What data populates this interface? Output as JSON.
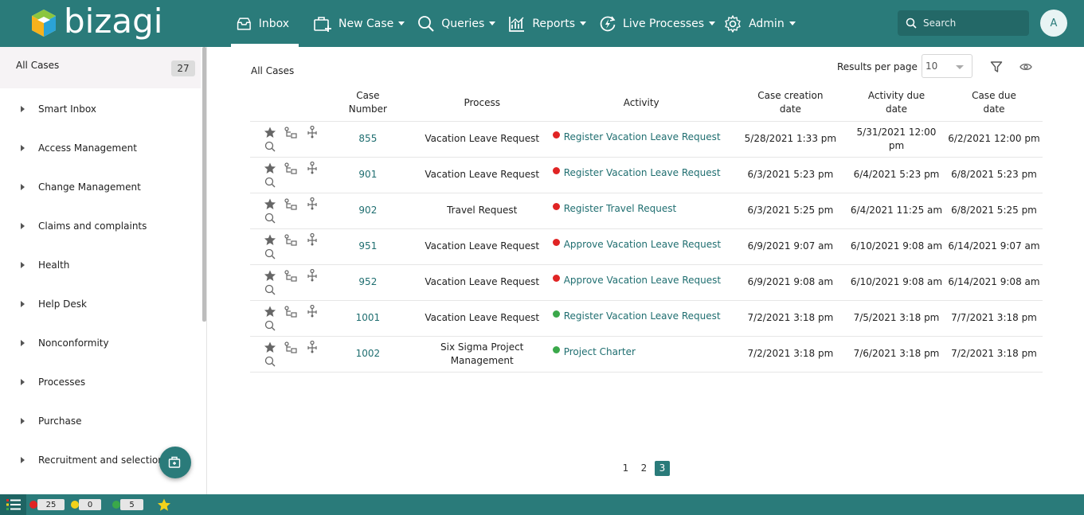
{
  "brand": {
    "name": "bizagi"
  },
  "nav": [
    {
      "label": "Inbox",
      "icon": "inbox-icon",
      "dropdown": false
    },
    {
      "label": "New Case",
      "icon": "new-case-icon",
      "dropdown": true
    },
    {
      "label": "Queries",
      "icon": "search-icon",
      "dropdown": true
    },
    {
      "label": "Reports",
      "icon": "chart-icon",
      "dropdown": true
    },
    {
      "label": "Live Processes",
      "icon": "live-process-icon",
      "dropdown": true
    },
    {
      "label": "Admin",
      "icon": "gear-icon",
      "dropdown": true
    }
  ],
  "search": {
    "placeholder": "Search"
  },
  "user": {
    "initial": "A"
  },
  "sidebar": {
    "all_cases_label": "All Cases",
    "all_cases_count": "27",
    "items": [
      "Smart Inbox",
      "Access Management",
      "Change Management",
      "Claims and complaints",
      "Health",
      "Help Desk",
      "Nonconformity",
      "Processes",
      "Purchase",
      "Recruitment and selection"
    ]
  },
  "main": {
    "title": "All Cases",
    "results_per_page_label": "Results per page",
    "results_per_page_value": "10",
    "columns": {
      "case_number": [
        "Case",
        "Number"
      ],
      "process": "Process",
      "activity": "Activity",
      "creation": [
        "Case creation",
        "date"
      ],
      "activity_due": [
        "Activity due",
        "date"
      ],
      "case_due": [
        "Case due",
        "date"
      ]
    },
    "rows": [
      {
        "number": "855",
        "process": "Vacation Leave Request",
        "activity": "Register Vacation Leave Request",
        "status": "red",
        "created": "5/28/2021 1:33 pm",
        "activity_due": "5/31/2021 12:00 pm",
        "case_due": "6/2/2021 12:00 pm"
      },
      {
        "number": "901",
        "process": "Vacation Leave Request",
        "activity": "Register Vacation Leave Request",
        "status": "red",
        "created": "6/3/2021 5:23 pm",
        "activity_due": "6/4/2021 5:23 pm",
        "case_due": "6/8/2021 5:23 pm"
      },
      {
        "number": "902",
        "process": "Travel Request",
        "activity": "Register Travel Request",
        "status": "red",
        "created": "6/3/2021 5:25 pm",
        "activity_due": "6/4/2021 11:25 am",
        "case_due": "6/8/2021 5:25 pm"
      },
      {
        "number": "951",
        "process": "Vacation Leave Request",
        "activity": "Approve Vacation Leave Request",
        "status": "red",
        "created": "6/9/2021 9:07 am",
        "activity_due": "6/10/2021 9:08 am",
        "case_due": "6/14/2021 9:07 am"
      },
      {
        "number": "952",
        "process": "Vacation Leave Request",
        "activity": "Approve Vacation Leave Request",
        "status": "red",
        "created": "6/9/2021 9:08 am",
        "activity_due": "6/10/2021 9:08 am",
        "case_due": "6/14/2021 9:08 am"
      },
      {
        "number": "1001",
        "process": "Vacation Leave Request",
        "activity": "Register Vacation Leave Request",
        "status": "green",
        "created": "7/2/2021 3:18 pm",
        "activity_due": "7/5/2021 3:18 pm",
        "case_due": "7/7/2021 3:18 pm"
      },
      {
        "number": "1002",
        "process": "Six Sigma Project Management",
        "process_lines": [
          "Six Sigma Project",
          "Management"
        ],
        "activity": "Project Charter",
        "status": "green",
        "created": "7/2/2021 3:18 pm",
        "activity_due": "7/6/2021 3:18 pm",
        "case_due": "7/2/2021 3:18 pm"
      }
    ],
    "pages": [
      "1",
      "2",
      "3"
    ],
    "current_page": "3"
  },
  "statusbar": {
    "red_count": "25",
    "yellow_count": "0",
    "green_count": "5"
  },
  "colors": {
    "brand": "#2a7b7a",
    "red": "#e02424",
    "yellow": "#f2d21b",
    "green": "#3aa84a",
    "star": "#f2d21b"
  }
}
